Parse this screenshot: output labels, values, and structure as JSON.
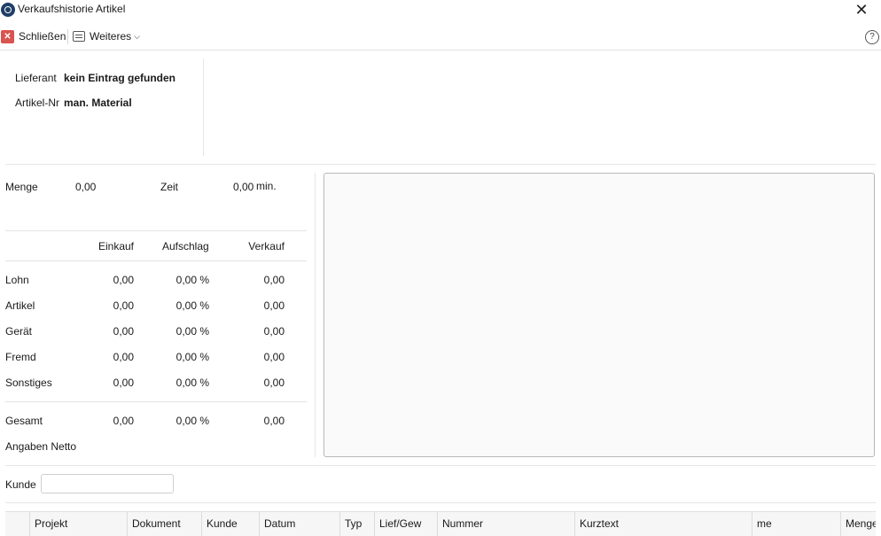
{
  "window": {
    "title": "Verkaufshistorie Artikel"
  },
  "toolbar": {
    "close_label": "Schließen",
    "more_label": "Weiteres"
  },
  "info": {
    "lieferant_label": "Lieferant",
    "lieferant_value": "kein Eintrag gefunden",
    "artikel_label": "Artikel-Nr",
    "artikel_value": "man. Material"
  },
  "summary": {
    "menge_label": "Menge",
    "menge_value": "0,00",
    "zeit_label": "Zeit",
    "zeit_value": "0,00",
    "zeit_unit": "min."
  },
  "prices": {
    "headers": [
      "Einkauf",
      "Aufschlag",
      "Verkauf"
    ],
    "rows": [
      {
        "label": "Lohn",
        "einkauf": "0,00",
        "aufschlag": "0,00 %",
        "verkauf": "0,00"
      },
      {
        "label": "Artikel",
        "einkauf": "0,00",
        "aufschlag": "0,00 %",
        "verkauf": "0,00"
      },
      {
        "label": "Gerät",
        "einkauf": "0,00",
        "aufschlag": "0,00 %",
        "verkauf": "0,00"
      },
      {
        "label": "Fremd",
        "einkauf": "0,00",
        "aufschlag": "0,00 %",
        "verkauf": "0,00"
      },
      {
        "label": "Sonstiges",
        "einkauf": "0,00",
        "aufschlag": "0,00 %",
        "verkauf": "0,00"
      }
    ],
    "total": {
      "label": "Gesamt",
      "einkauf": "0,00",
      "aufschlag": "0,00 %",
      "verkauf": "0,00"
    },
    "note": "Angaben Netto"
  },
  "filter": {
    "kunde_label": "Kunde",
    "kunde_value": ""
  },
  "grid": {
    "columns": [
      "",
      "Projekt",
      "Dokument",
      "Kunde",
      "Datum",
      "Typ",
      "Lief/Gew",
      "Nummer",
      "Kurztext",
      "me",
      "Menge"
    ]
  }
}
